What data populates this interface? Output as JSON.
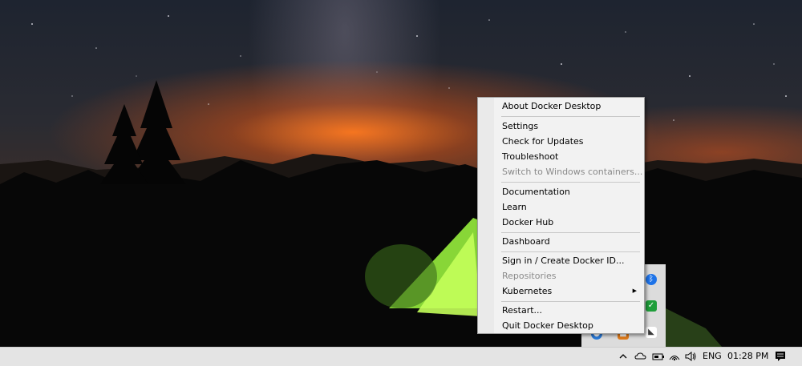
{
  "menu": {
    "items": [
      {
        "label": "About Docker Desktop",
        "enabled": true
      },
      {
        "label": "Settings",
        "enabled": true
      },
      {
        "label": "Check for Updates",
        "enabled": true
      },
      {
        "label": "Troubleshoot",
        "enabled": true
      },
      {
        "label": "Switch to Windows containers...",
        "enabled": false
      },
      {
        "label": "Documentation",
        "enabled": true
      },
      {
        "label": "Learn",
        "enabled": true
      },
      {
        "label": "Docker Hub",
        "enabled": true
      },
      {
        "label": "Dashboard",
        "enabled": true
      },
      {
        "label": "Sign in / Create Docker ID...",
        "enabled": true
      },
      {
        "label": "Repositories",
        "enabled": false
      },
      {
        "label": "Kubernetes",
        "enabled": true,
        "submenu": true
      },
      {
        "label": "Restart...",
        "enabled": true
      },
      {
        "label": "Quit Docker Desktop",
        "enabled": true
      }
    ]
  },
  "tray_overflow": {
    "icons": [
      "bluetooth-icon",
      "check-shield-icon",
      "docker-whale-icon",
      "blue-shield-icon",
      "orange-app-icon"
    ]
  },
  "taskbar": {
    "icons": [
      "chevron-up-icon",
      "onedrive-cloud-icon",
      "battery-icon",
      "speaker-icon",
      "wifi-icon",
      "notification-icon"
    ],
    "language": "ENG",
    "time": "01:28 PM"
  },
  "colors": {
    "menu_bg": "#f2f2f2",
    "disabled_text": "#8a8a8a",
    "taskbar_bg": "#e4e4e4",
    "sky_glow": "#ff7a1e",
    "tent_green": "#8fe23a"
  }
}
